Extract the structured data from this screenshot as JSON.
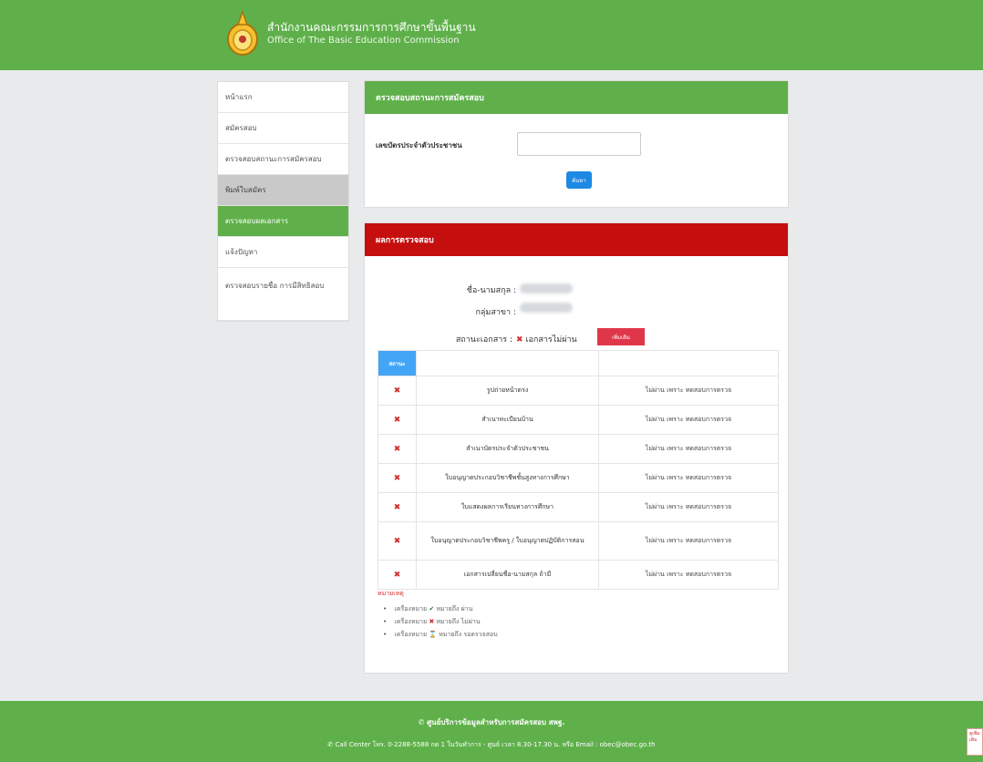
{
  "header": {
    "title_th": "สำนักงานคณะกรรมการการศึกษาขั้นพื้นฐาน",
    "title_en": "Office of The Basic Education Commission"
  },
  "sidebar": {
    "items": [
      {
        "label": "หน้าแรก"
      },
      {
        "label": "สมัครสอบ"
      },
      {
        "label": "ตรวจสอบสถานะการสมัครสอบ"
      },
      {
        "label": "พิมพ์ใบสมัคร"
      },
      {
        "label": "ตรวจสอบผลเอกสาร"
      },
      {
        "label": "แจ้งปัญหา"
      },
      {
        "label": "ตรวจสอบรายชื่อ การมีสิทธิสอบ"
      }
    ]
  },
  "search_panel": {
    "title": "ตรวจสอบสถานะการสมัครสอบ",
    "field_label": "เลขบัตรประจำตัวประชาชน",
    "input_value": "",
    "button_label": "ค้นหา"
  },
  "result_panel": {
    "title": "ผลการตรวจสอบ",
    "name_label": "ชื่อ-นามสกุล :",
    "group_label": "กลุ่มสาขา :",
    "status_label": "สถานะเอกสาร :",
    "status_icon": "✖",
    "status_value": "เอกสารไม่ผ่าน",
    "detail_button": "เพิ่มเติม",
    "table": {
      "header_status": "สถานะ",
      "rows": [
        {
          "icon": "✖",
          "name": "รูปถ่ายหน้าตรง",
          "result": "ไม่ผ่าน เพราะ ทดสอบการตรวจ"
        },
        {
          "icon": "✖",
          "name": "สำเนาทะเบียนบ้าน",
          "result": "ไม่ผ่าน เพราะ ทดสอบการตรวจ"
        },
        {
          "icon": "✖",
          "name": "สำเนาบัตรประจำตัวประชาชน",
          "result": "ไม่ผ่าน เพราะ ทดสอบการตรวจ"
        },
        {
          "icon": "✖",
          "name": "ใบอนุญาตประกอบวิชาชีพชั้นสูงทางการศึกษา",
          "result": "ไม่ผ่าน เพราะ ทดสอบการตรวจ"
        },
        {
          "icon": "✖",
          "name": "ใบแสดงผลการเรียนทางการศึกษา",
          "result": "ไม่ผ่าน เพราะ ทดสอบการตรวจ"
        },
        {
          "icon": "✖",
          "name": "ใบอนุญาตประกอบวิชาชีพครู / ใบอนุญาตปฏิบัติการสอน",
          "result": "ไม่ผ่าน เพราะ ทดสอบการตรวจ"
        },
        {
          "icon": "✖",
          "name": "เอกสารเปลี่ยนชื่อ-นามสกุล ถ้ามี",
          "result": "ไม่ผ่าน เพราะ ทดสอบการตรวจ"
        }
      ]
    },
    "notes": {
      "title": "หมายเหตุ",
      "items": [
        {
          "icon": "✔",
          "color": "#2e7d32",
          "text_before": "เครื่องหมาย",
          "text_after": "หมายถึง ผ่าน"
        },
        {
          "icon": "✖",
          "color": "#d32f2f",
          "text_before": "เครื่องหมาย",
          "text_after": "หมายถึง ไม่ผ่าน"
        },
        {
          "icon": "⌛",
          "color": "#333333",
          "text_before": "เครื่องหมาย",
          "text_after": "หมายถึง รอตรวจสอบ"
        }
      ]
    }
  },
  "footer": {
    "line1": "ศูนย์บริการข้อมูลสำหรับการสมัครสอบ สพฐ.",
    "line2": "Call Center โทร. 0-2288-5588 กด 1 ในวันทำการ - ศูนย์ เวลา 8.30-17.30 น. หรือ Email : obec@obec.go.th"
  },
  "corner": {
    "label": "ดูเพิ่มเติม"
  },
  "colors": {
    "green": "#5fb04a",
    "red": "#c50f0f",
    "blue": "#1e88e5"
  }
}
